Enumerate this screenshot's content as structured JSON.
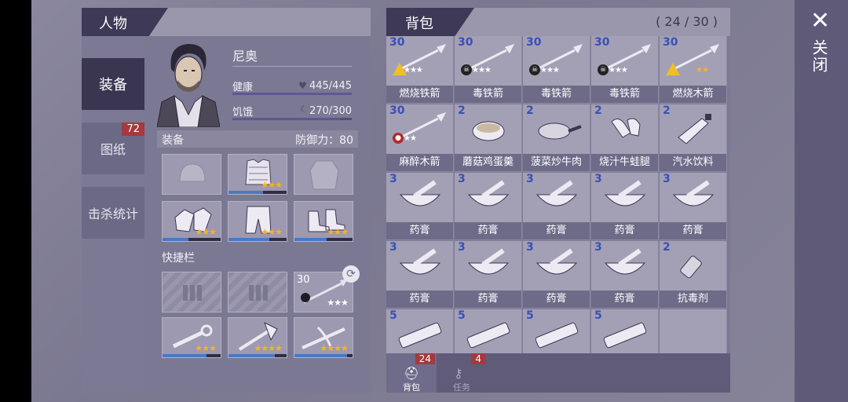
{
  "close": {
    "label": "关闭"
  },
  "character": {
    "title": "人物",
    "tabs": [
      {
        "label": "装备",
        "active": true
      },
      {
        "label": "图纸",
        "badge": "72"
      },
      {
        "label": "击杀统计"
      }
    ],
    "name": "尼奥",
    "health": {
      "label": "健康",
      "value": "445/445",
      "fraction": 1.0
    },
    "hunger": {
      "label": "饥饿",
      "value": "270/300",
      "fraction": 0.9
    },
    "equipment": {
      "label": "装备",
      "defense_label": "防御力：",
      "defense_value": "80",
      "slots": [
        {
          "name": "helmet",
          "stars": "",
          "durability": 0
        },
        {
          "name": "body-armor",
          "stars": "★★★",
          "durability": 0.6
        },
        {
          "name": "jacket",
          "stars": "",
          "durability": 0
        },
        {
          "name": "gloves",
          "stars": "★★★",
          "durability": 0.45
        },
        {
          "name": "pants",
          "stars": "★★★",
          "durability": 0.7
        },
        {
          "name": "boots",
          "stars": "★★★",
          "durability": 0.55
        }
      ]
    },
    "quickbar": {
      "label": "快捷栏",
      "slots": [
        {
          "name": "empty-slot-1"
        },
        {
          "name": "empty-slot-2"
        },
        {
          "name": "spear-arrow",
          "qty": "30",
          "stars": "★★★"
        },
        {
          "name": "wrench",
          "stars": "★★★",
          "durability": 0.75
        },
        {
          "name": "axe",
          "stars": "★★★★",
          "durability": 0.8
        },
        {
          "name": "crossbow",
          "stars": "★★★★",
          "durability": 0.9
        }
      ]
    }
  },
  "backpack": {
    "title": "背包",
    "count": "( 24 / 30 )",
    "items": [
      {
        "qty": "30",
        "label": "燃烧铁箭",
        "icon": "arrow",
        "stars": "★★★",
        "mark": "warn"
      },
      {
        "qty": "30",
        "label": "毒铁箭",
        "icon": "arrow",
        "stars": "★★★",
        "mark": "skull"
      },
      {
        "qty": "30",
        "label": "毒铁箭",
        "icon": "arrow",
        "stars": "★★★",
        "mark": "skull"
      },
      {
        "qty": "30",
        "label": "毒铁箭",
        "icon": "arrow",
        "stars": "★★★",
        "mark": "skull"
      },
      {
        "qty": "30",
        "label": "燃烧木箭",
        "icon": "arrow",
        "stars": "★★",
        "mark": "warn",
        "gold": true
      },
      {
        "qty": "30",
        "label": "麻醉木箭",
        "icon": "arrow",
        "stars": "★★",
        "mark": "dart"
      },
      {
        "qty": "2",
        "label": "蘑菇鸡蛋羹",
        "icon": "bowl"
      },
      {
        "qty": "2",
        "label": "菠菜炒牛肉",
        "icon": "pan"
      },
      {
        "qty": "2",
        "label": "烧汁牛蛙腿",
        "icon": "legs"
      },
      {
        "qty": "2",
        "label": "汽水饮料",
        "icon": "bottle"
      },
      {
        "qty": "3",
        "label": "药膏",
        "icon": "mortar"
      },
      {
        "qty": "3",
        "label": "药膏",
        "icon": "mortar"
      },
      {
        "qty": "3",
        "label": "药膏",
        "icon": "mortar"
      },
      {
        "qty": "3",
        "label": "药膏",
        "icon": "mortar"
      },
      {
        "qty": "3",
        "label": "药膏",
        "icon": "mortar"
      },
      {
        "qty": "3",
        "label": "药膏",
        "icon": "mortar"
      },
      {
        "qty": "3",
        "label": "药膏",
        "icon": "mortar"
      },
      {
        "qty": "3",
        "label": "药膏",
        "icon": "mortar"
      },
      {
        "qty": "3",
        "label": "药膏",
        "icon": "mortar"
      },
      {
        "qty": "2",
        "label": "抗毒剂",
        "icon": "vial"
      },
      {
        "qty": "5",
        "label": "",
        "icon": "bandage"
      },
      {
        "qty": "5",
        "label": "",
        "icon": "bandage"
      },
      {
        "qty": "5",
        "label": "",
        "icon": "bandage"
      },
      {
        "qty": "5",
        "label": "",
        "icon": "bandage"
      }
    ],
    "footer": [
      {
        "label": "背包",
        "badge": "24",
        "icon": "backpack-icon",
        "active": true
      },
      {
        "label": "任务",
        "badge": "4",
        "icon": "key-icon",
        "active": false
      }
    ]
  }
}
